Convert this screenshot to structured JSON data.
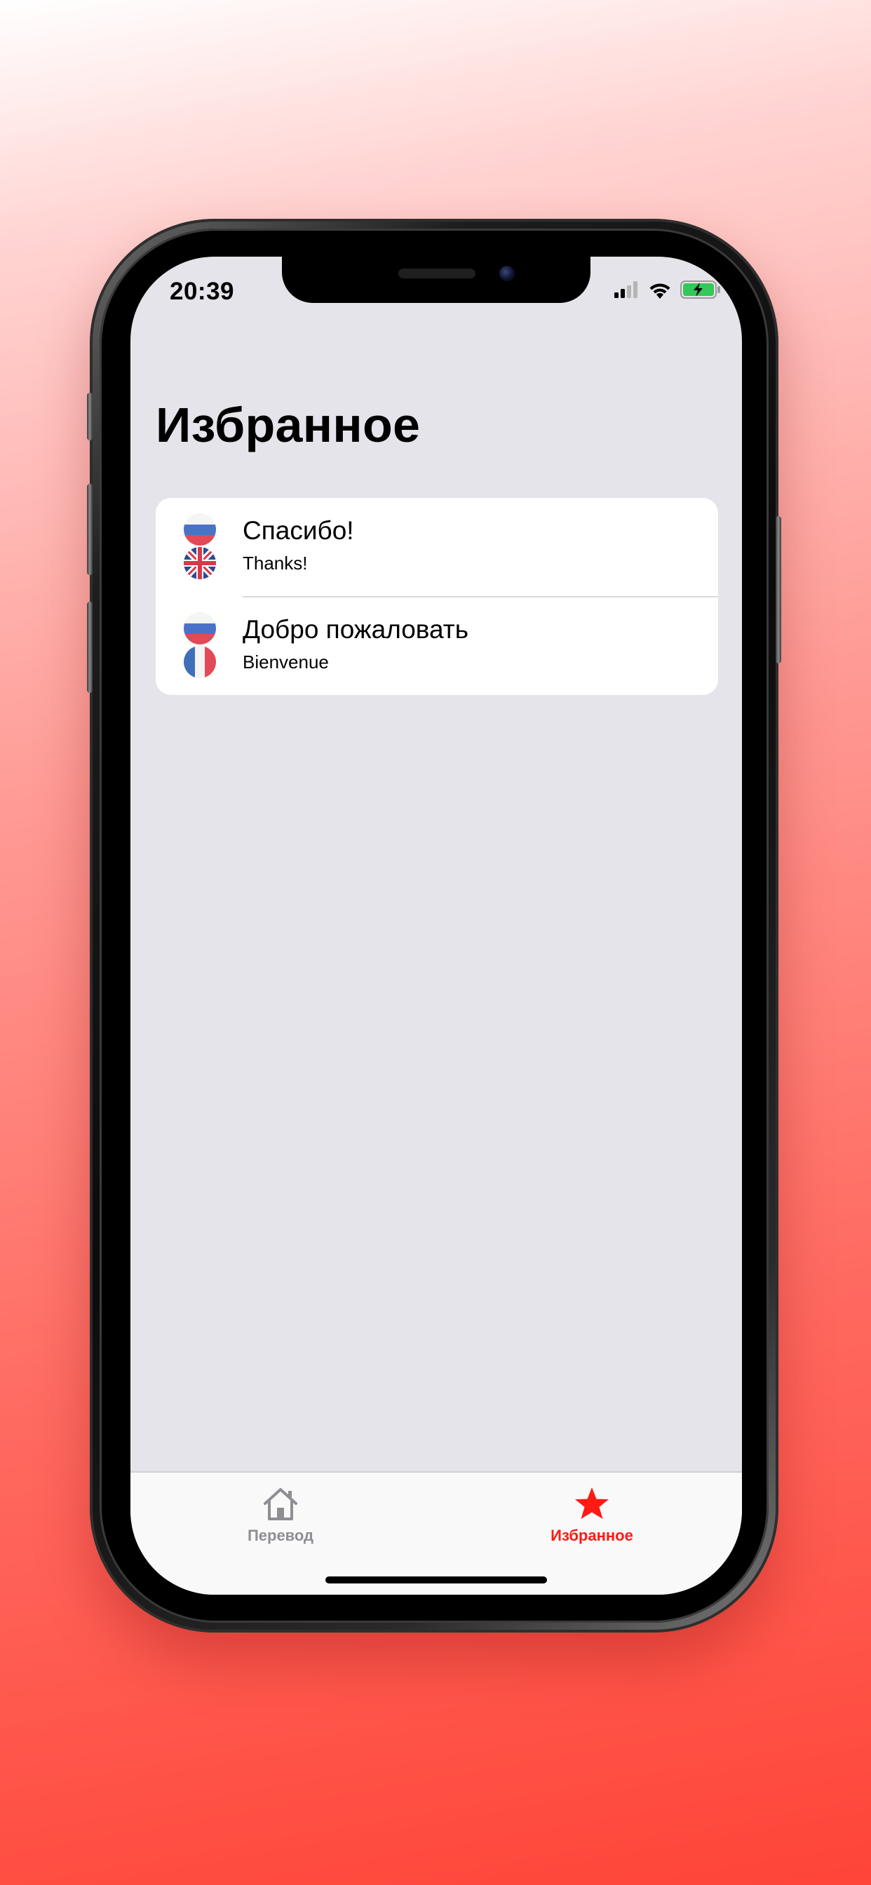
{
  "status_bar": {
    "time": "20:39"
  },
  "page": {
    "title": "Избранное"
  },
  "favorites": [
    {
      "source_text": "Спасибо!",
      "translation": "Thanks!",
      "source_flag": "russia-flag-icon",
      "target_flag": "uk-flag-icon"
    },
    {
      "source_text": "Добро пожаловать",
      "translation": "Bienvenue",
      "source_flag": "russia-flag-icon",
      "target_flag": "france-flag-icon"
    }
  ],
  "tabbar": {
    "tabs": [
      {
        "label": "Перевод",
        "icon": "house-icon",
        "selected": false
      },
      {
        "label": "Избранное",
        "icon": "star-icon",
        "selected": true
      }
    ]
  },
  "colors": {
    "accent": "#ff1a14",
    "inactive_tab": "#8e8e93",
    "background": "#e5e4ea",
    "card": "#ffffff"
  }
}
